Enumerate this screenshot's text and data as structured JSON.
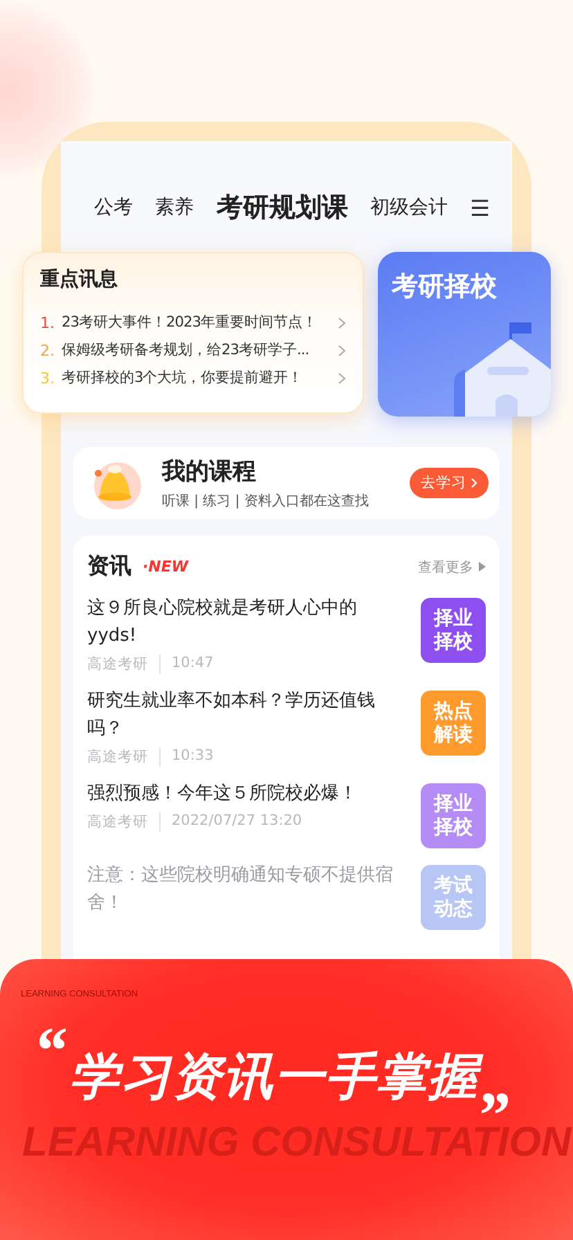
{
  "tabs": [
    {
      "label": "公考",
      "selected": false
    },
    {
      "label": "素养",
      "selected": false
    },
    {
      "label": "考研规划课",
      "selected": true
    },
    {
      "label": "初级会计",
      "selected": false
    }
  ],
  "menu_icon": "☰",
  "keynote": {
    "title": "重点讯息",
    "items": [
      {
        "number": "1.",
        "color": "#f5483b",
        "text": "23考研大事件！2023年重要时间节点！"
      },
      {
        "number": "2.",
        "color": "#f7a23a",
        "text": "保姆级考研备考规划，给23考研学子..."
      },
      {
        "number": "3.",
        "color": "#f7c53a",
        "text": "考研择校的3个大坑，你要提前避开！"
      }
    ]
  },
  "school_card": {
    "title": "考研择校"
  },
  "my_course": {
    "title": "我的课程",
    "subtitle": "听课 | 练习 | 资料入口都在这查找",
    "button": "去学习"
  },
  "news": {
    "title": "资讯",
    "badge": "·NEW",
    "more": "查看更多",
    "items": [
      {
        "title": "这９所良心院校就是考研人心中的yyds!",
        "source": "高途考研",
        "time": "10:47",
        "tag": "择业择校",
        "color": "#8d4ff0",
        "dimmed": false
      },
      {
        "title": "研究生就业率不如本科？学历还值钱吗？",
        "source": "高途考研",
        "time": "10:33",
        "tag": "热点解读",
        "color": "#ff9a2c",
        "dimmed": false
      },
      {
        "title": "强烈预感！今年这５所院校必爆！",
        "source": "高途考研",
        "time": "2022/07/27 13:20",
        "tag": "择业择校",
        "color": "#b58cf6",
        "dimmed": false
      },
      {
        "title": "注意：这些院校明确通知专硕不提供宿舍！",
        "tag": "考试动态",
        "color": "#b7c6f5",
        "dimmed": true
      }
    ]
  },
  "banner": {
    "small_caption": "LEARNING CONSULTATION",
    "open_quote": "“",
    "headline": "学习资讯一手掌握",
    "close_quote": "„",
    "background_text": "LEARNING CONSULTATION"
  }
}
